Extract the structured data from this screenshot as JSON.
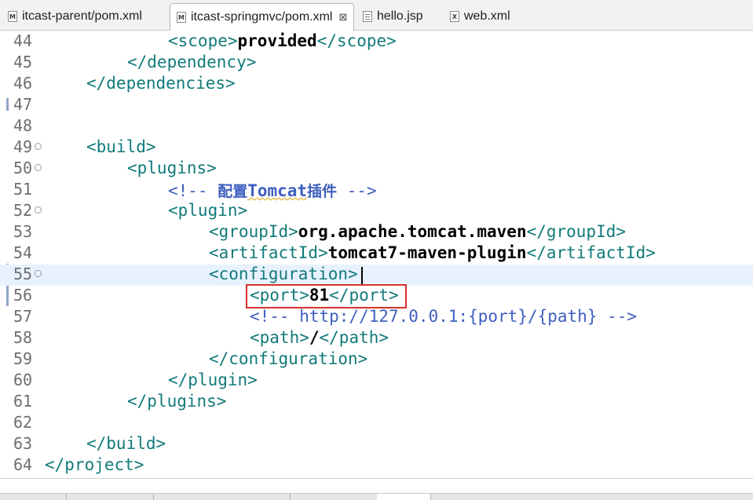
{
  "tabs": [
    {
      "label": "itcast-parent/pom.xml",
      "icon": "maven-pom-icon"
    },
    {
      "label": "itcast-springmvc/pom.xml",
      "icon": "maven-pom-icon",
      "active": true,
      "close": "⊠"
    },
    {
      "label": "hello.jsp",
      "icon": "jsp-file-icon"
    },
    {
      "label": "web.xml",
      "icon": "xml-file-icon"
    }
  ],
  "icon_glyphs": {
    "maven": "M",
    "xml": "X"
  },
  "editor": {
    "lines": [
      {
        "n": "44",
        "parts": [
          [
            "tag",
            "<scope>"
          ],
          [
            "txt",
            "provided"
          ],
          [
            "tag",
            "</scope>"
          ]
        ]
      },
      {
        "n": "45",
        "parts": [
          [
            "tag",
            "</dependency>"
          ]
        ]
      },
      {
        "n": "46",
        "parts": [
          [
            "tag",
            "</dependencies>"
          ]
        ]
      },
      {
        "n": "47",
        "parts": []
      },
      {
        "n": "48",
        "parts": []
      },
      {
        "n": "49",
        "fold": true,
        "parts": [
          [
            "tag",
            "<build>"
          ]
        ]
      },
      {
        "n": "50",
        "fold": true,
        "parts": [
          [
            "tag",
            "<plugins>"
          ]
        ]
      },
      {
        "n": "51",
        "parts": [
          [
            "cmt",
            "<!-- "
          ],
          [
            "cmt-cjk",
            "配置"
          ],
          [
            "cmt-sq",
            "Tomcat"
          ],
          [
            "cmt-cjk",
            "插件"
          ],
          [
            "cmt",
            " -->"
          ]
        ]
      },
      {
        "n": "52",
        "fold": true,
        "parts": [
          [
            "tag",
            "<plugin>"
          ]
        ]
      },
      {
        "n": "53",
        "parts": [
          [
            "tag",
            "<groupId>"
          ],
          [
            "txt",
            "org.apache.tomcat.maven"
          ],
          [
            "tag",
            "</groupId>"
          ]
        ]
      },
      {
        "n": "54",
        "parts": [
          [
            "tag",
            "<artifactId>"
          ],
          [
            "txt",
            "tomcat7-maven-plugin"
          ],
          [
            "tag",
            "</artifactId>"
          ]
        ]
      },
      {
        "n": "55",
        "fold": true,
        "current": true,
        "parts": [
          [
            "tag",
            "<configuration>"
          ]
        ]
      },
      {
        "n": "56",
        "parts": [
          [
            "tag",
            "<port>"
          ],
          [
            "txt",
            "81"
          ],
          [
            "tag",
            "</port>"
          ]
        ]
      },
      {
        "n": "57",
        "parts": [
          [
            "cmt",
            "<!-- http://127.0.0.1:{port}/{path} -->"
          ]
        ]
      },
      {
        "n": "58",
        "parts": [
          [
            "tag",
            "<path>"
          ],
          [
            "txt",
            "/"
          ],
          [
            "tag",
            "</path>"
          ]
        ]
      },
      {
        "n": "59",
        "parts": [
          [
            "tag",
            "</configuration>"
          ]
        ]
      },
      {
        "n": "60",
        "parts": [
          [
            "tag",
            "</plugin>"
          ]
        ]
      },
      {
        "n": "61",
        "parts": [
          [
            "tag",
            "</plugins>"
          ]
        ]
      },
      {
        "n": "62",
        "parts": []
      },
      {
        "n": "63",
        "parts": [
          [
            "tag",
            "</build>"
          ]
        ]
      },
      {
        "n": "64",
        "parts": [
          [
            "tag",
            "</project>"
          ]
        ]
      }
    ],
    "fold_glyph": "⊖"
  },
  "colors": {
    "tag": "#127a7a",
    "text": "#000000",
    "comment": "#3f5fbf",
    "current_line": "#e8f2fe",
    "highlight_box": "#d9322b"
  }
}
